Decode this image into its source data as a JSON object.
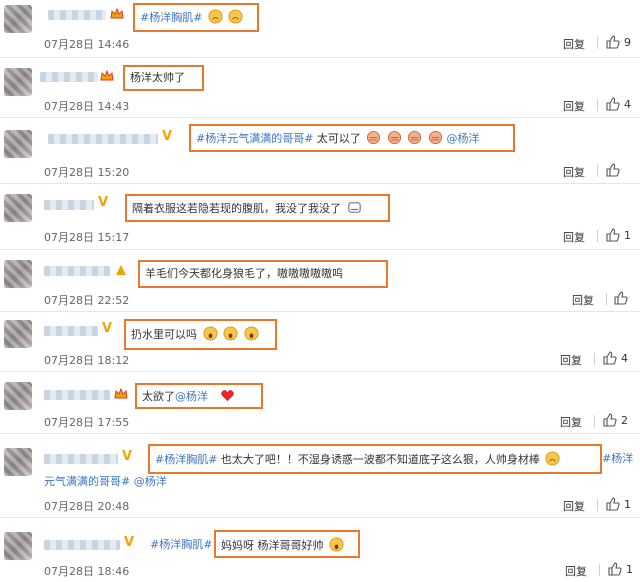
{
  "comments": [
    {
      "hashtag": "#杨洋胸肌#",
      "text": "",
      "time": "07月28日 14:46",
      "reply": "回复",
      "likes": "9"
    },
    {
      "text": "杨洋太帅了",
      "time": "07月28日 14:43",
      "reply": "回复",
      "likes": "4"
    },
    {
      "hashtag": "#杨洋元气满满的哥哥#",
      "text": " 太可以了",
      "mention": "@杨洋",
      "time": "07月28日 15:20",
      "reply": "回复",
      "likes": ""
    },
    {
      "text": "隔着衣服这若隐若现的腹肌，我没了我没了",
      "time": "07月28日 15:17",
      "reply": "回复",
      "likes": "1"
    },
    {
      "text": "羊毛们今天都化身狼毛了，嗷嗷嗷嗷嗷呜",
      "time": "07月28日 22:52",
      "reply": "回复",
      "likes": ""
    },
    {
      "text": "扔水里可以吗",
      "time": "07月28日 18:12",
      "reply": "回复",
      "likes": "4"
    },
    {
      "text": "太欲了",
      "mention": "@杨洋",
      "time": "07月28日 17:55",
      "reply": "回复",
      "likes": "2"
    },
    {
      "hashtag": "#杨洋胸肌#",
      "text": " 也太大了吧！！不湿身诱惑一波都不知道底子这么狠，人帅身材棒",
      "hashtag2": "#杨洋",
      "line2_hashtag": "元气满满的哥哥#",
      "line2_mention": "@杨洋",
      "time": "07月28日 20:48",
      "reply": "回复",
      "likes": "1"
    },
    {
      "hashtag": "#杨洋胸肌#",
      "text": "妈妈呀 杨洋哥哥好帅",
      "time": "07月28日 18:46",
      "reply": "回复",
      "likes": "1"
    }
  ],
  "colors": {
    "accent_box": "#e8782a",
    "link": "#3c75c4",
    "heart": "#e8262a"
  }
}
